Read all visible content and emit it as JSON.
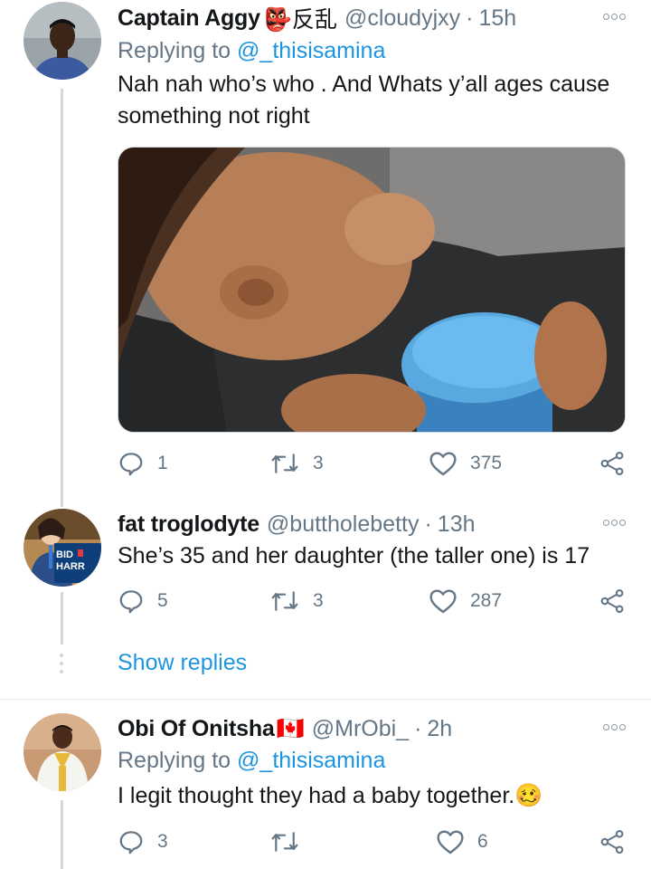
{
  "tweets": [
    {
      "name": "Captain Aggy",
      "badge": "👺反乱",
      "handle": "@cloudyjxy",
      "dot": "·",
      "time": "15h",
      "replying_prefix": "Replying to ",
      "replying_to": "@_thisisamina",
      "text": "Nah nah who’s who . And Whats y’all ages cause something not right",
      "media": "video-thumbnail",
      "stats": {
        "replies": "1",
        "retweets": "3",
        "likes": "375"
      }
    },
    {
      "name": "fat troglodyte",
      "badge": "",
      "handle": "@buttholebetty",
      "dot": "·",
      "time": "13h",
      "text": "She’s 35 and her daughter (the taller one) is 17",
      "avatar_sign": [
        "BID",
        "HARR"
      ],
      "stats": {
        "replies": "5",
        "retweets": "3",
        "likes": "287"
      }
    },
    {
      "name": "Obi Of Onitsha",
      "badge": "🇨🇦",
      "handle": "@MrObi_",
      "dot": "·",
      "time": "2h",
      "replying_prefix": "Replying to ",
      "replying_to": "@_thisisamina",
      "text": "I legit thought they had a baby together.",
      "text_emoji": "🥴",
      "stats": {
        "replies": "3",
        "retweets": "",
        "likes": "6"
      }
    }
  ],
  "show_replies": "Show replies",
  "icons": [
    "reply-icon",
    "retweet-icon",
    "like-icon",
    "share-icon",
    "more-icon"
  ],
  "colors": {
    "link": "#1b95e0",
    "muted": "#657786",
    "text": "#14171a",
    "line": "#cfd9de"
  }
}
